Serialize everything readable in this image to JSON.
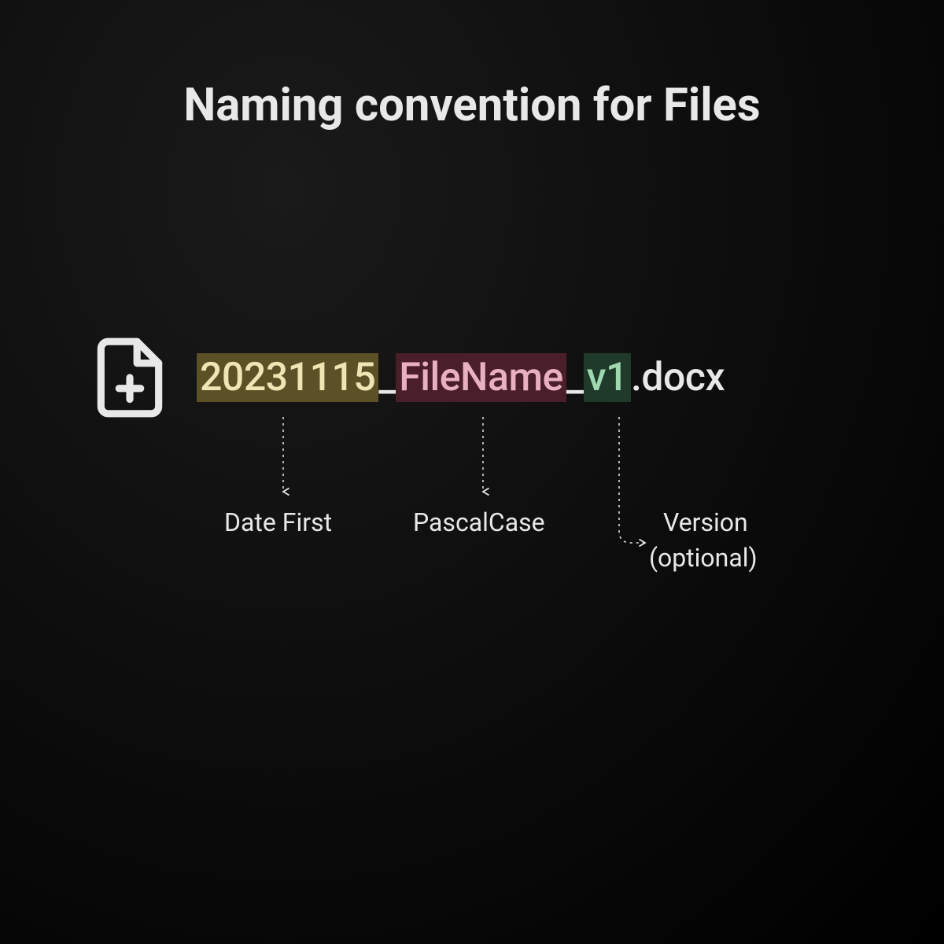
{
  "title": "Naming convention for Files",
  "segments": {
    "date": "20231115",
    "sep1": "_",
    "name": "FileName",
    "sep2": "_",
    "version": "v1",
    "ext": ".docx"
  },
  "annotations": {
    "date_label": "Date First",
    "name_label": "PascalCase",
    "version_label_1": "Version",
    "version_label_2": "(optional)"
  },
  "colors": {
    "date_bg": "#5b5026",
    "date_fg": "#f0e4b5",
    "name_bg": "#4b1f2a",
    "name_fg": "#e8b0c0",
    "version_bg": "#1f3a2b",
    "version_fg": "#9fd8b0"
  }
}
